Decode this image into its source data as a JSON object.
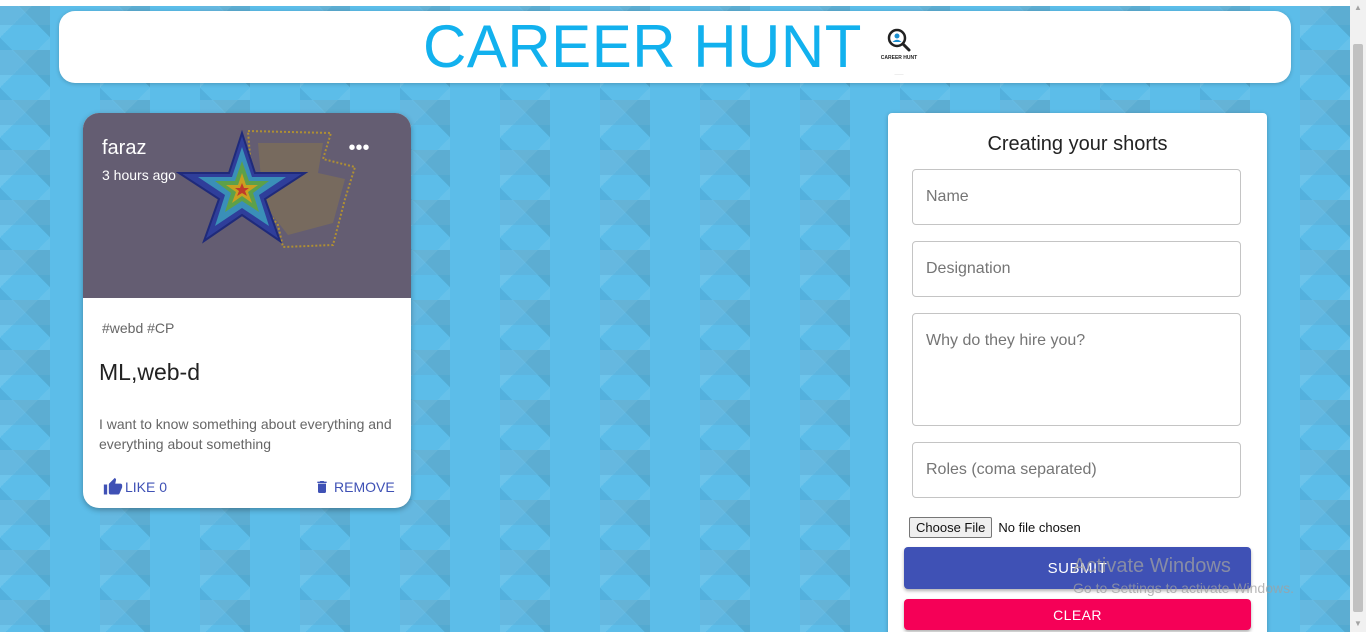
{
  "header": {
    "title": "CAREER HUNT",
    "logo_text": "CAREER HUNT",
    "logo_icon": "magnifier-person-icon"
  },
  "post": {
    "creator": "faraz",
    "created_time": "3 hours ago",
    "more_icon": "more-horizontal-icon",
    "tags": "#webd #CP",
    "title": "ML,web-d",
    "message": "I want to know something about everything and everything about something",
    "like_label": "LIKE 0",
    "like_icon": "thumb-up-icon",
    "remove_label": "REMOVE",
    "remove_icon": "trash-icon",
    "media_color": "#645d72",
    "action_color": "#3f51b5"
  },
  "form": {
    "heading": "Creating your shorts",
    "name_placeholder": "Name",
    "designation_placeholder": "Designation",
    "why_placeholder": "Why do they hire you?",
    "roles_placeholder": "Roles (coma separated)",
    "file_button": "Choose File",
    "file_status": "No file chosen",
    "submit_label": "SUBMIT",
    "clear_label": "CLEAR",
    "submit_color": "#3f51b5",
    "clear_color": "#f50057"
  },
  "watermark": {
    "title": "Activate Windows",
    "subtitle": "Go to Settings to activate Windows."
  },
  "theme": {
    "title_color": "#12b1ee",
    "background_color": "#5cbde9"
  }
}
